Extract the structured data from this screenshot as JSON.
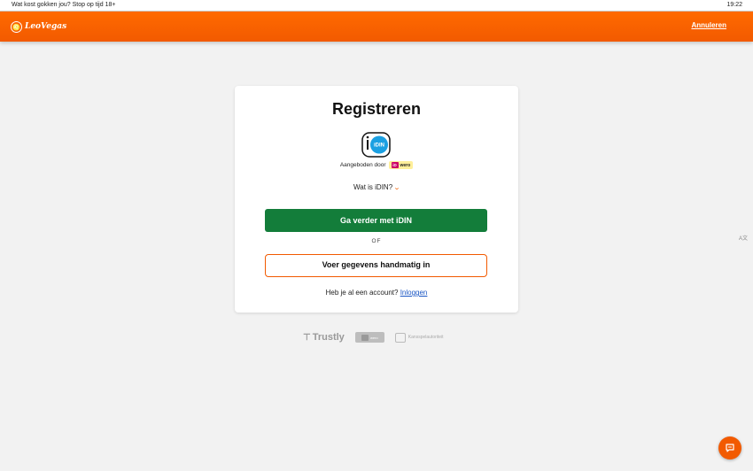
{
  "status_bar": {
    "warning": "Wat kost gokken jou? Stop op tijd 18+",
    "time": "19:22"
  },
  "header": {
    "logo": "LeoVegas",
    "cancel_label": "Annuleren"
  },
  "card": {
    "title": "Registreren",
    "idin_icon_label": "iDIN",
    "offered_by": "Aangeboden door",
    "offered_brand": "wero",
    "what_is_idin": "Wat is iDIN?",
    "continue_idin_label": "Ga verder met iDIN",
    "or_label": "OF",
    "manual_label": "Voer gegevens handmatig in",
    "has_account_text": "Heb je al een account?",
    "login_label": "Inloggen"
  },
  "partners": {
    "trustly": "Trustly",
    "ideal": "wero",
    "ksa": "Kansspelautoriteit"
  },
  "colors": {
    "brand_orange": "#f25a00",
    "primary_green": "#137d3a",
    "link_blue": "#1a56c4"
  },
  "icons": {
    "chat": "chat-bubble-icon",
    "expand": "chevron-down-icon",
    "translate": "translate-icon"
  }
}
